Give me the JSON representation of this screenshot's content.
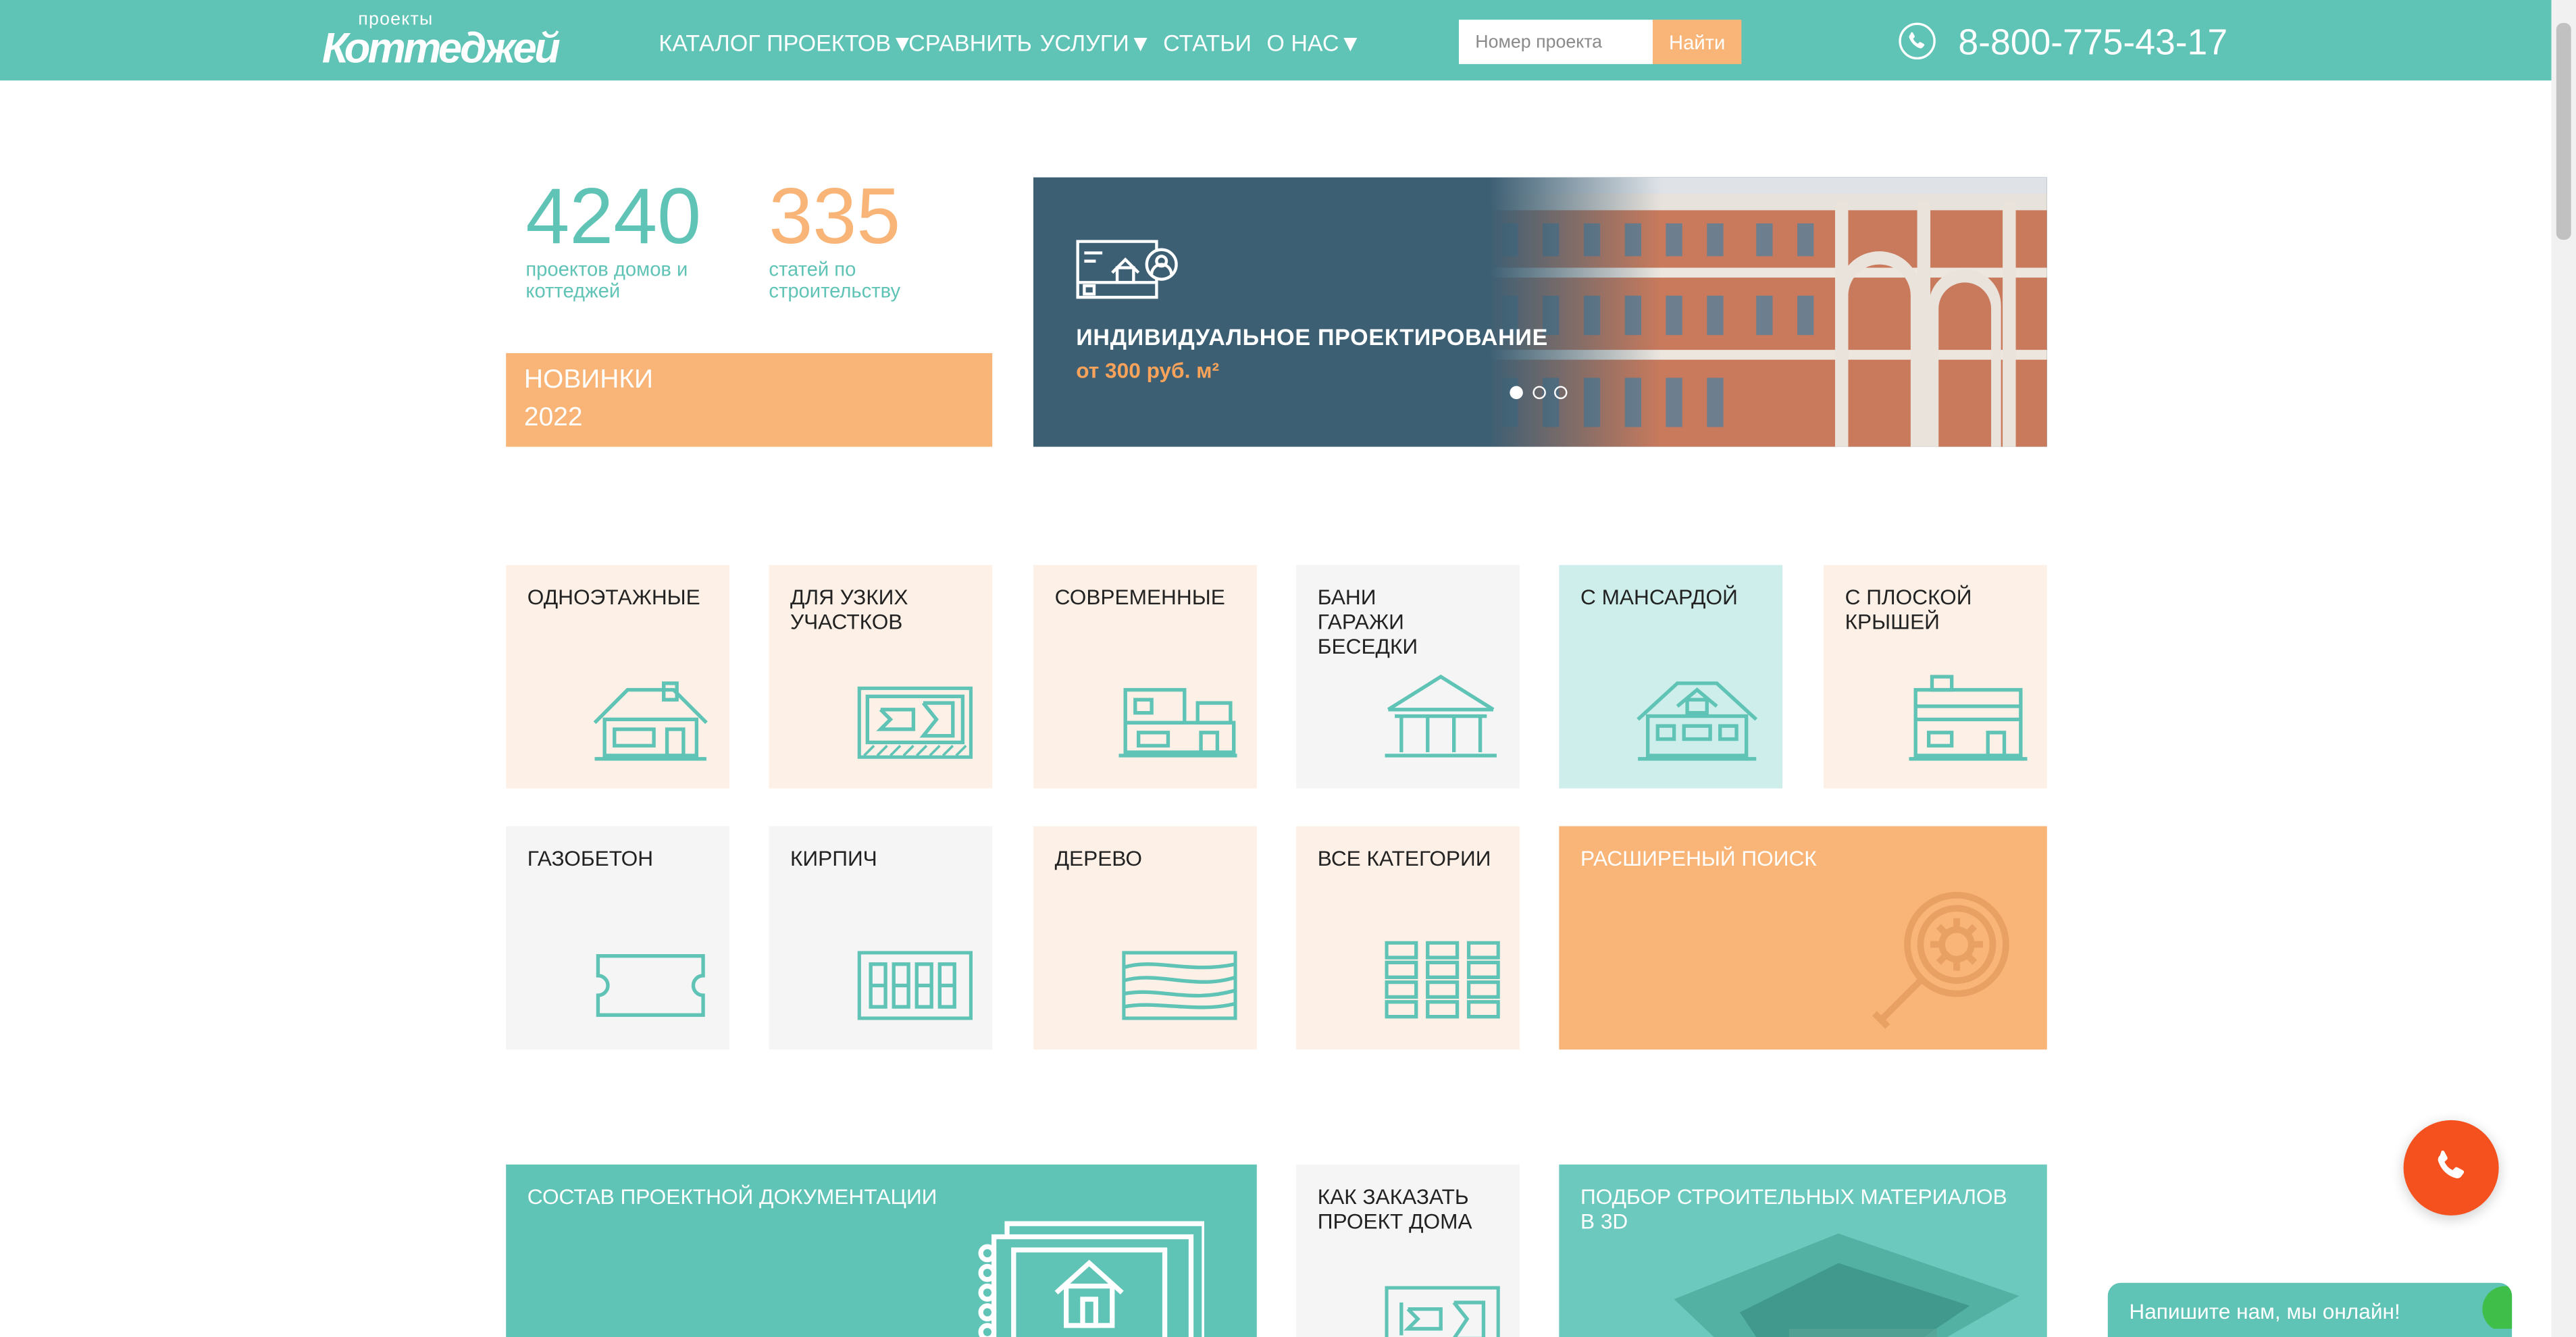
{
  "header": {
    "logo_small": "проекты",
    "logo_big": "Коттеджей",
    "nav": [
      "КАТАЛОГ ПРОЕКТОВ▼",
      "СРАВНИТЬ",
      "УСЛУГИ▼",
      "СТАТЬИ",
      "О НАС▼"
    ],
    "search_placeholder": "Номер проекта",
    "search_button": "Найти",
    "phone": "8-800-775-43-17"
  },
  "stats": {
    "projects_count": "4240",
    "projects_label": "проектов домов и коттеджей",
    "articles_count": "335",
    "articles_label": "статей по строительству"
  },
  "new_box": {
    "line1": "НОВИНКИ",
    "line2": "2022"
  },
  "banner": {
    "title": "ИНДИВИДУАЛЬНОЕ ПРОЕКТИРОВАНИЕ",
    "price": "от  300 руб. м²",
    "slide_count": 3,
    "active_slide": 1
  },
  "tiles": [
    {
      "label": "ОДНОЭТАЖНЫЕ",
      "icon": "one-storey-house-icon"
    },
    {
      "label": "ДЛЯ УЗКИХ\nУЧАСТКОВ",
      "icon": "narrow-plot-icon"
    },
    {
      "label": "СОВРЕМЕННЫЕ",
      "icon": "modern-house-icon"
    },
    {
      "label": "БАНИ\nГАРАЖИ\nБЕСЕДКИ",
      "icon": "gazebo-icon"
    },
    {
      "label": "С МАНСАРДОЙ",
      "icon": "attic-house-icon"
    },
    {
      "label": "С ПЛОСКОЙ\nКРЫШЕЙ",
      "icon": "flat-roof-house-icon"
    },
    {
      "label": "ГАЗОБЕТОН",
      "icon": "aerated-block-icon"
    },
    {
      "label": "КИРПИЧ",
      "icon": "brick-icon"
    },
    {
      "label": "ДЕРЕВО",
      "icon": "wood-icon"
    },
    {
      "label": "ВСЕ КАТЕГОРИИ",
      "icon": "grid-icon"
    },
    {
      "label": "РАСШИРЕНЫЙ ПОИСК",
      "icon": "advanced-search-icon"
    },
    {
      "label": "СОСТАВ ПРОЕКТНОЙ ДОКУМЕНТАЦИИ",
      "icon": "documentation-icon"
    },
    {
      "label": "КАК ЗАКАЗАТЬ\nПРОЕКТ ДОМА",
      "icon": "order-project-icon"
    },
    {
      "label": "ПОДБОР СТРОИТЕЛЬНЫХ МАТЕРИАЛОВ\nВ 3D",
      "icon": "house-3d-icon"
    }
  ],
  "chat": {
    "text": "Напишите нам, мы онлайн!"
  },
  "colors": {
    "teal": "#5fc3b6",
    "orange": "#f8b577",
    "peach": "#fdf0e6",
    "grey": "#f5f5f5",
    "mint": "#cdeeea",
    "navy": "#3d5f73",
    "call": "#f4511e"
  }
}
